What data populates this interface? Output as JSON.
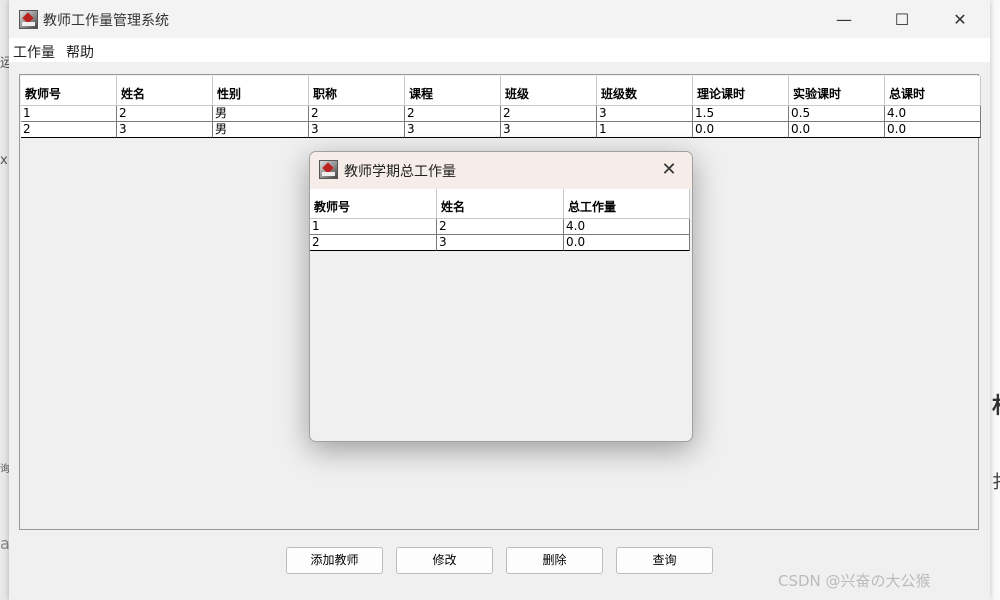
{
  "window": {
    "title": "教师工作量管理系统",
    "minimize_glyph": "—",
    "maximize_glyph": "☐",
    "close_glyph": "✕"
  },
  "menu": [
    "工作量",
    "帮助"
  ],
  "teacher_table": {
    "columns": [
      "教师号",
      "姓名",
      "性别",
      "职称",
      "课程",
      "班级",
      "班级数",
      "理论课时",
      "实验课时",
      "总课时"
    ],
    "rows": [
      [
        "1",
        "2",
        "男",
        "2",
        "2",
        "2",
        "3",
        "1.5",
        "0.5",
        "4.0"
      ],
      [
        "2",
        "3",
        "男",
        "3",
        "3",
        "3",
        "1",
        "0.0",
        "0.0",
        "0.0"
      ]
    ]
  },
  "buttons": {
    "add": "添加教师",
    "edit": "修改",
    "delete": "删除",
    "query": "查询"
  },
  "dialog": {
    "title": "教师学期总工作量",
    "close_glyph": "✕",
    "columns": [
      "教师号",
      "姓名",
      "总工作量"
    ],
    "rows": [
      [
        "1",
        "2",
        "4.0"
      ],
      [
        "2",
        "3",
        "0.0"
      ]
    ]
  },
  "background_fragments": {
    "left_top": "运",
    "left_mid": "x",
    "left_low": "询",
    "left_bottom": "a",
    "right_top": "村",
    "right_bottom": "扌"
  },
  "watermark": "CSDN @兴奋の大公猴"
}
